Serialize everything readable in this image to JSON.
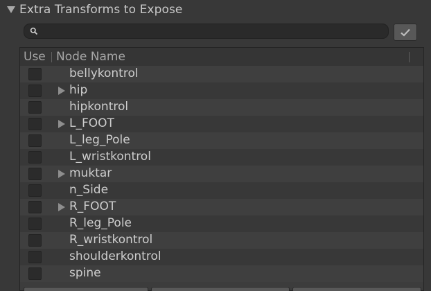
{
  "foldout": {
    "label": "Extra Transforms to Expose"
  },
  "search": {
    "value": "",
    "placeholder": "",
    "icon": "search-icon"
  },
  "confirm_button": {
    "icon": "checkmark-icon"
  },
  "table": {
    "headers": {
      "use": "Use",
      "node_name": "Node Name"
    },
    "rows": [
      {
        "label": "bellykontrol",
        "expandable": false,
        "checked": false
      },
      {
        "label": "hip",
        "expandable": true,
        "checked": false
      },
      {
        "label": "hipkontrol",
        "expandable": false,
        "checked": false
      },
      {
        "label": "L_FOOT",
        "expandable": true,
        "checked": false
      },
      {
        "label": "L_leg_Pole",
        "expandable": false,
        "checked": false
      },
      {
        "label": "L_wristkontrol",
        "expandable": false,
        "checked": false
      },
      {
        "label": "muktar",
        "expandable": true,
        "checked": false
      },
      {
        "label": "n_Side",
        "expandable": false,
        "checked": false
      },
      {
        "label": "R_FOOT",
        "expandable": true,
        "checked": false
      },
      {
        "label": "R_leg_Pole",
        "expandable": false,
        "checked": false
      },
      {
        "label": "R_wristkontrol",
        "expandable": false,
        "checked": false
      },
      {
        "label": "shoulderkontrol",
        "expandable": false,
        "checked": false
      },
      {
        "label": "spine",
        "expandable": false,
        "checked": false
      }
    ]
  },
  "colors": {
    "background": "#383838",
    "row_alt": "#3f3f3f",
    "text": "#cdcdcd"
  }
}
